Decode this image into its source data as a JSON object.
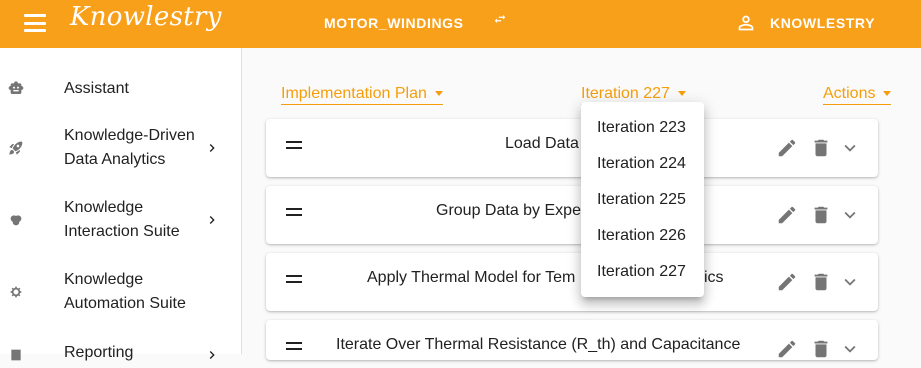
{
  "header": {
    "logo_text": "Knowlestry",
    "project": "MOTOR_WINDINGS",
    "swap_icon": "swap-icon",
    "user_name": "KNOWLESTRY"
  },
  "sidebar": {
    "items": [
      {
        "label": "Assistant",
        "icon": "robot-icon"
      },
      {
        "label": "Knowledge-Driven Data Analytics",
        "line1": "Knowledge-Driven",
        "line2": "Data Analytics",
        "icon": "rocket-icon"
      },
      {
        "label": "Knowledge Interaction Suite",
        "line1": "Knowledge",
        "line2": "Interaction Suite",
        "icon": "brain-icon"
      },
      {
        "label": "Knowledge Automation Suite",
        "line1": "Knowledge",
        "line2": "Automation Suite",
        "icon": "gear-icon"
      },
      {
        "label": "Reporting",
        "icon": "report-icon"
      }
    ]
  },
  "toolbar": {
    "plan_label": "Implementation Plan",
    "iteration_label": "Iteration 227",
    "actions_label": "Actions"
  },
  "steps": [
    {
      "title": "Load Data"
    },
    {
      "title": "Group Data by Expe"
    },
    {
      "title": "Apply Thermal Model for Tem",
      "title_tail": "ics"
    },
    {
      "title": "Iterate Over Thermal Resistance (R_th) and Capacitance"
    }
  ],
  "iteration_menu": {
    "options": [
      "Iteration 223",
      "Iteration 224",
      "Iteration 225",
      "Iteration 226",
      "Iteration 227"
    ]
  },
  "colors": {
    "accent": "#f9a01b",
    "link": "#f59e0b",
    "icon_gray": "#757575"
  }
}
